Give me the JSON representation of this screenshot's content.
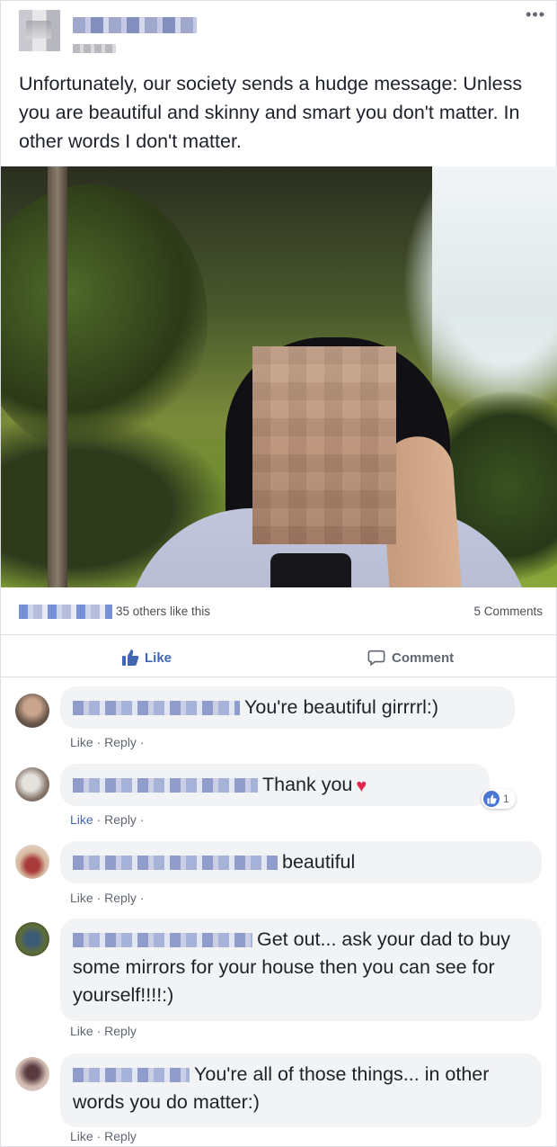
{
  "post": {
    "menu_icon": "ellipsis-icon",
    "text": "Unfortunately, our society sends a hudge message: Unless you are beautiful and skinny and smart you don't matter. In other words I don't matter.",
    "likes_text": "35 others like this",
    "comments_count": "5 Comments",
    "like_label": "Like",
    "comment_label": "Comment"
  },
  "colors": {
    "facebook_blue": "#4267b2",
    "bubble_gray": "#f2f3f5",
    "heart_red": "#e2264d"
  },
  "comments": [
    {
      "text": "You're beautiful girrrrl:)",
      "like": "Like",
      "reply": "Reply"
    },
    {
      "text": "Thank you",
      "like": "Like",
      "reply": "Reply",
      "reaction_count": "1"
    },
    {
      "text": "beautiful",
      "like": "Like",
      "reply": "Reply"
    },
    {
      "text": "Get out... ask your dad to buy some mirrors for your house then you can see for yourself!!!!:)",
      "like": "Like",
      "reply": "Reply"
    },
    {
      "text": "You're all of those things... in other words you do matter:)",
      "like": "Like",
      "reply": "Reply"
    }
  ]
}
